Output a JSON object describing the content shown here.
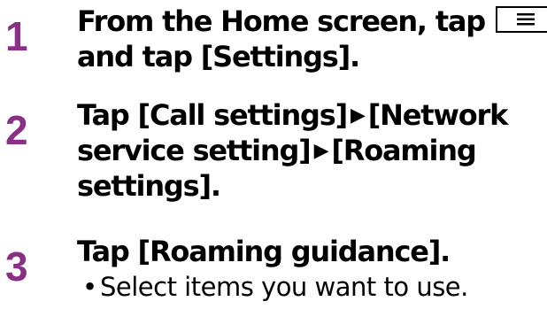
{
  "theme": {
    "accent": "#8a2f86"
  },
  "steps": [
    {
      "number": "1",
      "line1": "From the Home screen, tap",
      "menu_key_icon": "menu-key-icon",
      "line2": "and tap [Settings]."
    },
    {
      "number": "2",
      "line1a": "Tap [Call settings]",
      "arrow": "▶",
      "line1b": "[Network",
      "line2a": "service setting]",
      "line2b": "[Roaming",
      "line3": "settings]."
    },
    {
      "number": "3",
      "line1": "Tap [Roaming guidance].",
      "bullet": "•",
      "note": "Select items you want to use."
    }
  ]
}
